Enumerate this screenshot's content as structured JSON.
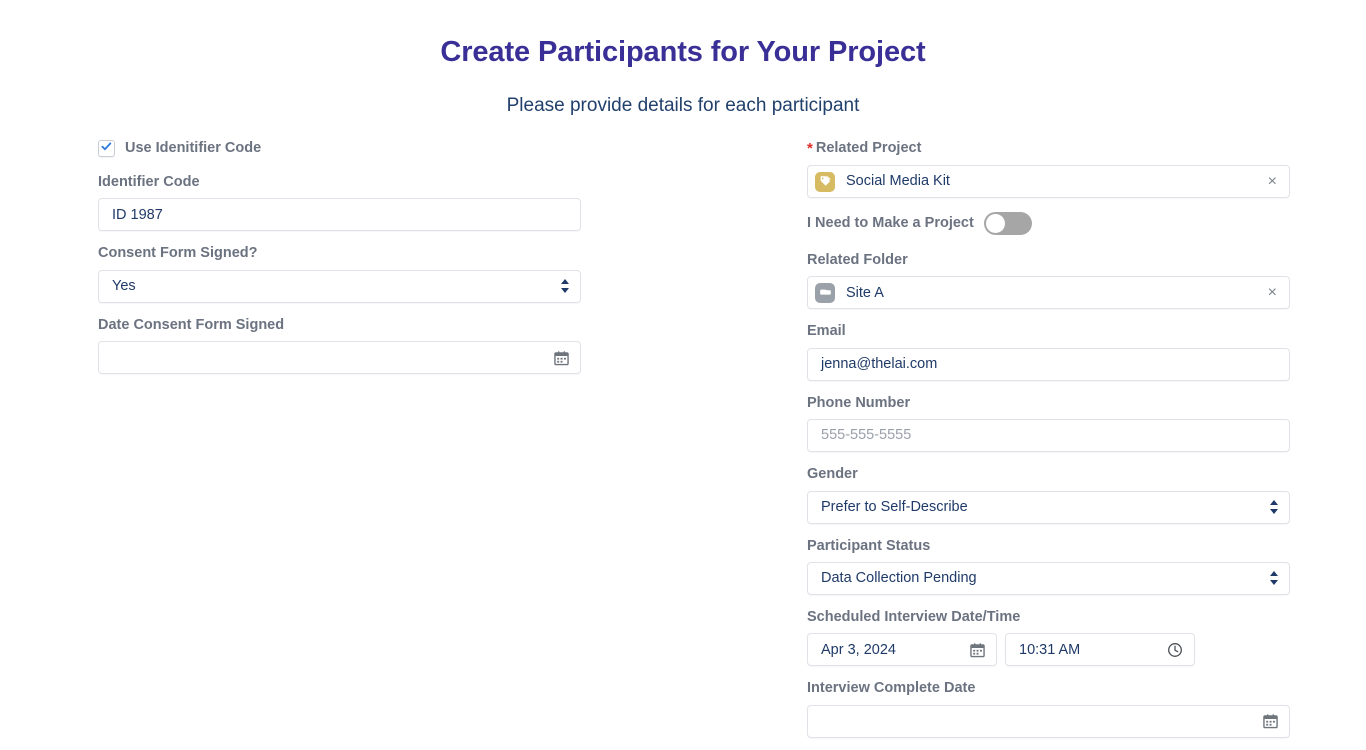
{
  "header": {
    "title": "Create Participants for Your Project",
    "subtitle": "Please provide details for each participant"
  },
  "left_column": {
    "use_identifier_checkbox": {
      "label": "Use Idenitifier Code",
      "checked": true,
      "icon": "check-icon"
    },
    "identifier_code": {
      "label": "Identifier Code",
      "value": "ID 1987"
    },
    "consent_form_signed": {
      "label": "Consent Form Signed?",
      "value": "Yes",
      "icon": "stepper-arrows-icon"
    },
    "date_consent_form_signed": {
      "label": "Date Consent Form Signed",
      "value": "",
      "icon": "calendar-icon"
    }
  },
  "right_column": {
    "related_project": {
      "label": "Related Project",
      "required_marker": "*",
      "value": "Social Media Kit",
      "chip_icon": "tags-icon",
      "chip_color": "#d6bb63",
      "clear_icon": "close-icon",
      "clear_glyph": "×"
    },
    "need_to_make_project": {
      "label": "I Need to Make a Project",
      "enabled": false
    },
    "related_folder": {
      "label": "Related Folder",
      "value": "Site A",
      "chip_icon": "folder-icon",
      "chip_color": "#9ba1a8",
      "clear_icon": "close-icon",
      "clear_glyph": "×"
    },
    "email": {
      "label": "Email",
      "value": "jenna@thelai.com"
    },
    "phone_number": {
      "label": "Phone Number",
      "placeholder": "555-555-5555",
      "value": ""
    },
    "gender": {
      "label": "Gender",
      "value": "Prefer to Self-Describe",
      "icon": "stepper-arrows-icon"
    },
    "participant_status": {
      "label": "Participant Status",
      "value": "Data Collection Pending",
      "icon": "stepper-arrows-icon"
    },
    "scheduled_interview": {
      "label": "Scheduled Interview Date/Time",
      "date_value": "Apr 3, 2024",
      "time_value": "10:31 AM",
      "date_icon": "calendar-icon",
      "time_icon": "clock-icon"
    },
    "interview_complete_date": {
      "label": "Interview Complete Date",
      "value": "",
      "icon": "calendar-icon"
    }
  },
  "theme": {
    "title_color": "#3a2f96",
    "subtitle_color": "#22406c",
    "label_color": "#6b7280",
    "value_color": "#1f3a68",
    "required_color": "#e02b27",
    "border_color": "#dfe3e8"
  }
}
